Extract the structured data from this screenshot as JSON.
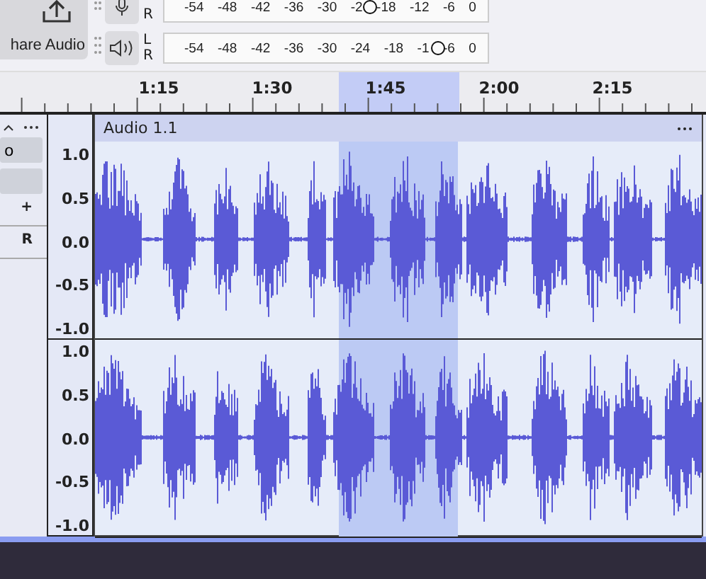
{
  "toolbar": {
    "share_button": {
      "label": "hare Audio"
    },
    "meters": [
      {
        "kind": "record",
        "channels": [
          "R"
        ],
        "ticks": [
          "-54",
          "-48",
          "-42",
          "-36",
          "-30",
          "-2",
          "-18",
          "-12",
          "-6",
          "0"
        ],
        "level": 0.638
      },
      {
        "kind": "playback",
        "channels": [
          "L",
          "R"
        ],
        "ticks": [
          "-54",
          "-48",
          "-42",
          "-36",
          "-30",
          "-24",
          "-18",
          "-1",
          "-6",
          "0"
        ],
        "level": 0.845
      }
    ]
  },
  "ruler": {
    "labels": [
      "1:15",
      "1:30",
      "1:45",
      "2:00",
      "2:15"
    ]
  },
  "track": {
    "controls": {
      "solo_label": "o",
      "gain_label": "+",
      "pan_label": "R"
    },
    "name": "Audio 1.1",
    "channels": [
      {
        "ticks": [
          "1.0",
          "0.5",
          "0.0",
          "-0.5",
          "-1.0"
        ]
      },
      {
        "ticks": [
          "1.0",
          "0.5",
          "0.0",
          "-0.5",
          "-1.0"
        ]
      }
    ]
  }
}
